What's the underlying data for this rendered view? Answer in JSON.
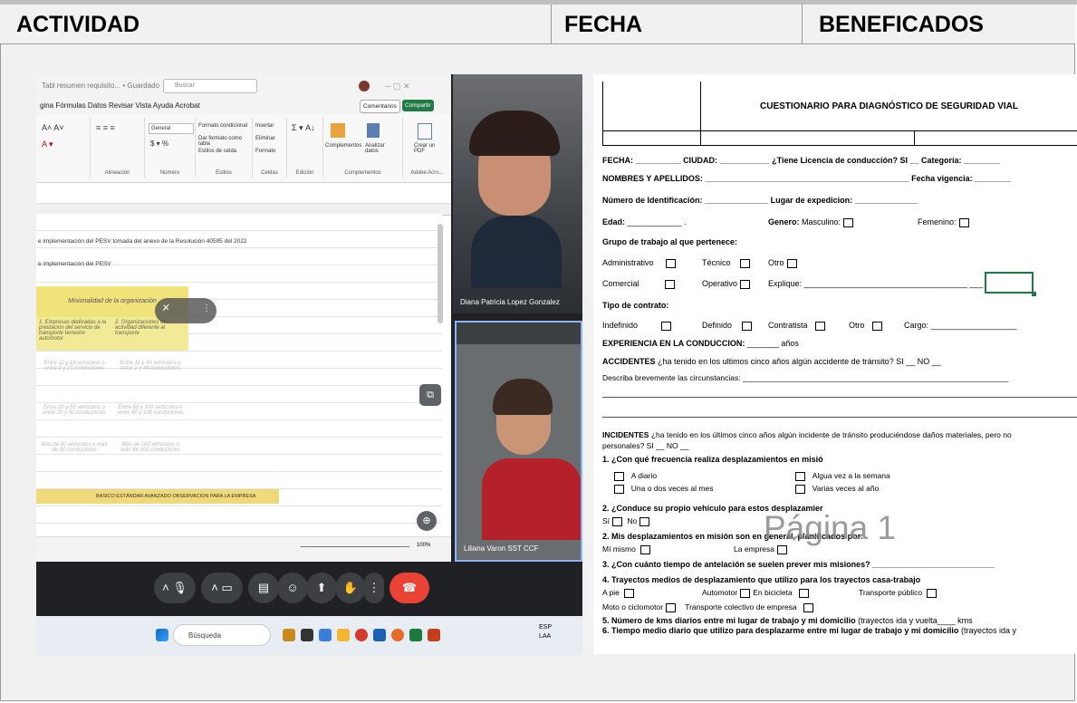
{
  "header": {
    "col1": "ACTIVIDAD",
    "col2": "FECHA",
    "col3": "BENEFICADOS"
  },
  "call": {
    "excel": {
      "title_text": "Tabl resumen requisito... • Guardado",
      "search_text": "Buscar",
      "menu": "gina   Fórmulas   Datos   Revisar   Vista   Ayuda   Acrobat",
      "comments_btn": "Comentarios",
      "share_btn": "Compartir",
      "ribbon_groups": [
        "Alineación",
        "Número",
        "Estilos",
        "Celdas",
        "Edición",
        "Complementos",
        "Adobe Acro..."
      ],
      "ribbon_items": [
        "General",
        "Formato condicional",
        "Dar formato como tabla",
        "Estilos de celda",
        "Insertar",
        "Eliminar",
        "Formato",
        "Complementos",
        "Analizar datos",
        "Crear un PDF"
      ],
      "row1": "e implementación del PESV tomada del anexo de la Resolución 40595 del 2022",
      "row2": "e implementación del PESV",
      "misionalidad": "Misionalidad de la organización",
      "col_a": "1. Empresas dedicadas a la prestación del servicio de transporte terrestre automotor",
      "col_b": "2. Organizaciones de... actividad diferente al transporte",
      "cells": [
        [
          "Entre 11 y 19 vehículos o entre 2 y 19 conductores",
          "Entre 11 y 49 vehículos o entre 2 y 49 conductores"
        ],
        [
          "Entre 20 y 50 vehículos o entre 20 y 50 conductores",
          "Entre 50 y 100 vehículos o entre 50 y 100 conductores"
        ],
        [
          "Más de 50 vehículos o más de 50 conductores",
          "Más de 100 vehículos o más de 100 conductores"
        ]
      ],
      "table_header": "BÁSICO   ESTÁNDAR   AVANZADO   OBSERVACION PARA LA EMPRESA",
      "zoom": "100%"
    },
    "participants": [
      {
        "name": "Diana Patricia Lopez Gonzalez"
      },
      {
        "name": "Liliana Varon SST CCF"
      }
    ],
    "taskbar": {
      "search": "Búsqueda",
      "lang_top": "ESP",
      "lang_bottom": "LAA"
    }
  },
  "form": {
    "title": "CUESTIONARIO PARA DIAGNÓSTICO DE SEGURIDAD VIAL",
    "fecha": "FECHA:",
    "ciudad": "CIUDAD:",
    "licencia": "¿Tiene Licencia de conducción? SI",
    "categoria": "Categoría:",
    "nombres": "NOMBRES Y APELLIDOS:",
    "fecha_vigencia": "Fecha vigencia:",
    "numero_id": "Número de Identificación:",
    "lugar_exp": "Lugar de expedicion:",
    "edad": "Edad:",
    "genero": "Genero:",
    "masculino": "Masculino:",
    "femenino": "Femenino:",
    "grupo": "Grupo de trabajo al que pertenece:",
    "administrativo": "Administrativo",
    "tecnico": "Técnico",
    "otro": "Otro",
    "comercial": "Comercial",
    "operativo": "Operativo",
    "explique": "Explique:",
    "tipo_contrato": "Tipo de contrato:",
    "indefinido": "Indefinido",
    "definido": "Definido",
    "contratista": "Contratista",
    "otro2": "Otro",
    "cargo": "Cargo:",
    "experiencia": "EXPERIENCIA EN LA CONDUCCION:",
    "anos": "años",
    "accidentes_b": "ACCIDENTES",
    "accidentes_q": "¿ha tenido en los ultimos cinco años algún accidente de tránsito? SI __ NO __",
    "describa": "Describa brevemente las circunstancias:",
    "incidentes_b": "INCIDENTES",
    "incidentes_q": "¿ha tenido en los últimos cinco años algún incidente de tránsito produciéndose daños materiales, pero no",
    "incidentes_q2": "personales? SI __ NO __",
    "q1": "1. ¿Con qué frecuencia realiza desplazamientos en misió",
    "q1_a": "A diario",
    "q1_b": "Algua vez a la semana",
    "q1_c": "Una o dos veces al mes",
    "q1_d": "Varias veces al año",
    "q2": "2. ¿Conduce su propio vehículo para estos desplazamier",
    "q2_opts": "Sí",
    "q2_no": "No",
    "q2b": "2. Mis desplazamientos en misión son en general, planificados por:",
    "mi_mismo": "Mí mismo",
    "la_empresa": "La empresa",
    "q3": "3. ¿Con cuánto tiempo de antelación se suelen prever mis misiones?",
    "q4": "4. Trayectos medios de desplazamiento que utilizo para los trayectos casa-trabajo",
    "q4_a": "A pie",
    "q4_b": "Automotor",
    "q4_c": "En bicicleta",
    "q4_d": "Transporte público",
    "q4_e": "Moto o ciclomotor",
    "q4_f": "Transporte colectivo de empresa",
    "q5_b": "5. Número de kms diarios entre mi lugar de trabajo y mi domicilio",
    "q5_r": "(trayectos ida y vuelta____ kms",
    "q6": "6. Tiempo medio diario que utilizo para desplazarme entre mi lugar de trabajo y mi domicilio",
    "q6_r": "(trayectos ida y",
    "pagina": "Página 1"
  }
}
